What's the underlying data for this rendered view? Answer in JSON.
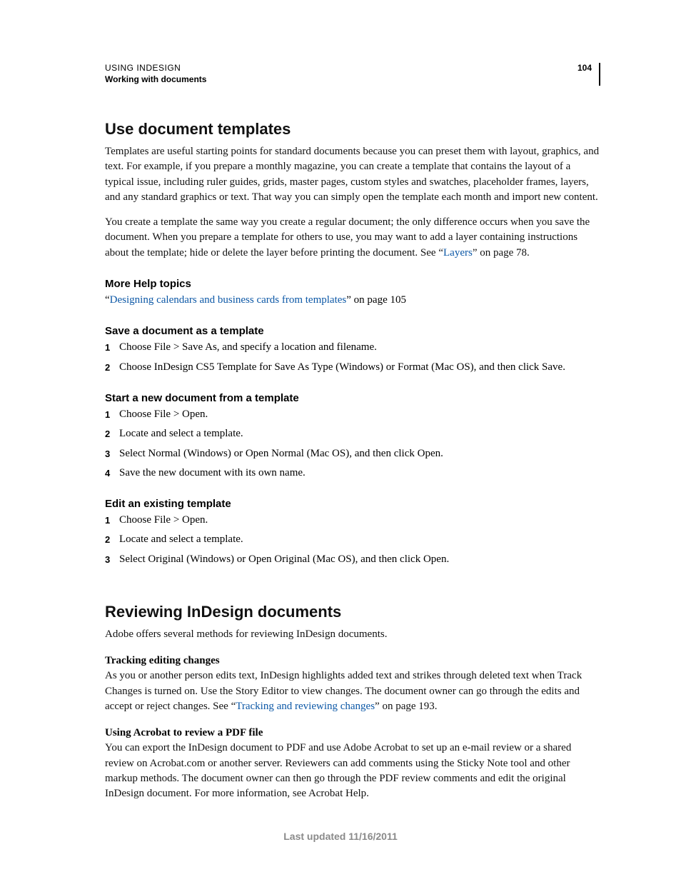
{
  "header": {
    "line1": "USING INDESIGN",
    "line2": "Working with documents",
    "page_number": "104"
  },
  "sections": {
    "use_templates": {
      "title": "Use document templates",
      "p1": "Templates are useful starting points for standard documents because you can preset them with layout, graphics, and text. For example, if you prepare a monthly magazine, you can create a template that contains the layout of a typical issue, including ruler guides, grids, master pages, custom styles and swatches, placeholder frames, layers, and any standard graphics or text. That way you can simply open the template each month and import new content.",
      "p2_a": "You create a template the same way you create a regular document; the only difference occurs when you save the document. When you prepare a template for others to use, you may want to add a layer containing instructions about the template; hide or delete the layer before printing the document. See “",
      "p2_link": "Layers",
      "p2_b": "” on page 78."
    },
    "more_help": {
      "title": "More Help topics",
      "pre": "“",
      "link": "Designing calendars and business cards from templates",
      "post": "” on page 105"
    },
    "save_as": {
      "title": "Save a document as a template",
      "steps": [
        "Choose File > Save As, and specify a location and filename.",
        "Choose InDesign CS5 Template for Save As Type (Windows) or Format (Mac OS), and then click Save."
      ]
    },
    "start_new": {
      "title": "Start a new document from a template",
      "steps": [
        "Choose File > Open.",
        "Locate and select a template.",
        "Select Normal (Windows) or Open Normal (Mac OS), and then click Open.",
        "Save the new document with its own name."
      ]
    },
    "edit_existing": {
      "title": "Edit an existing template",
      "steps": [
        "Choose File > Open.",
        "Locate and select a template.",
        "Select Original (Windows) or Open Original (Mac OS), and then click Open."
      ]
    },
    "reviewing": {
      "title": "Reviewing InDesign documents",
      "intro": "Adobe offers several methods for reviewing InDesign documents.",
      "tracking_heading": "Tracking editing changes",
      "tracking_a": "As you or another person edits text, InDesign highlights added text and strikes through deleted text when Track Changes is turned on. Use the Story Editor to view changes. The document owner can go through the edits and accept or reject changes. See “",
      "tracking_link": "Tracking and reviewing changes",
      "tracking_b": "” on page 193.",
      "acrobat_heading": "Using Acrobat to review a PDF file",
      "acrobat_body": "You can export the InDesign document to PDF and use Adobe Acrobat to set up an e-mail review or a shared review on Acrobat.com or another server. Reviewers can add comments using the Sticky Note tool and other markup methods. The document owner can then go through the PDF review comments and edit the original InDesign document. For more information, see Acrobat Help."
    }
  },
  "footer": "Last updated 11/16/2011"
}
